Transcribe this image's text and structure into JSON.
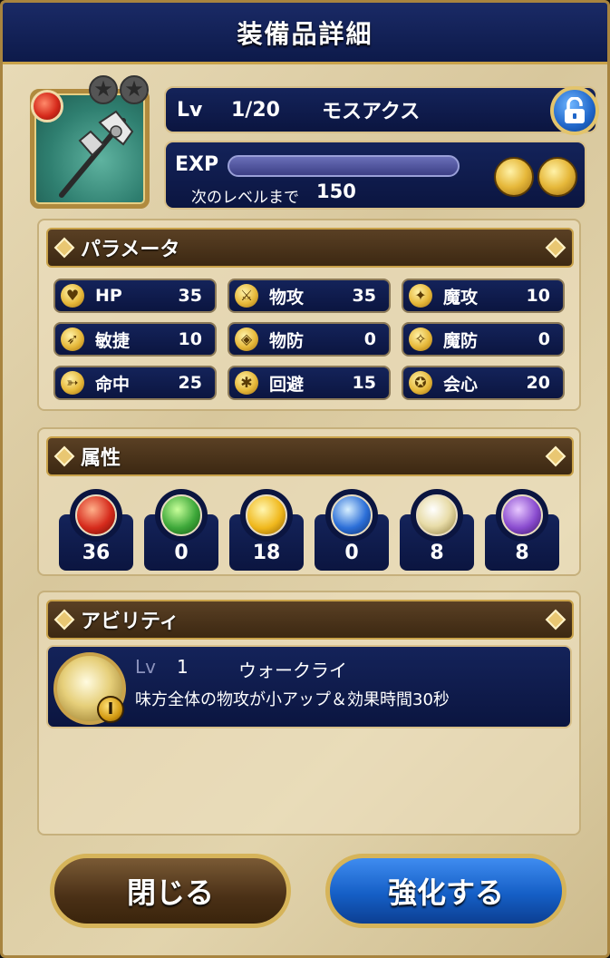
{
  "header": {
    "title": "装備品詳細"
  },
  "item": {
    "icon": "axe-weapon-icon",
    "element_badge": "fire-element-icon",
    "stars": [
      "★",
      "★"
    ],
    "level_label": "Lv",
    "level_value": "1/20",
    "name": "モスアクス",
    "lock_icon": "lock-icon"
  },
  "exp": {
    "label": "EXP",
    "progress": 0,
    "next_label": "次のレベルまで",
    "next_value": "150",
    "type_icons": [
      "shield-type-icon",
      "axe-type-icon"
    ]
  },
  "params": {
    "title": "パラメータ",
    "items": [
      {
        "label": "HP",
        "value": "35",
        "icon": "heart-icon"
      },
      {
        "label": "物攻",
        "value": "35",
        "icon": "sword-icon"
      },
      {
        "label": "魔攻",
        "value": "10",
        "icon": "staff-icon"
      },
      {
        "label": "敏捷",
        "value": "10",
        "icon": "wing-icon"
      },
      {
        "label": "物防",
        "value": "0",
        "icon": "shield-icon"
      },
      {
        "label": "魔防",
        "value": "0",
        "icon": "magic-guard-icon"
      },
      {
        "label": "命中",
        "value": "25",
        "icon": "bow-icon"
      },
      {
        "label": "回避",
        "value": "15",
        "icon": "dodge-icon"
      },
      {
        "label": "会心",
        "value": "20",
        "icon": "critical-icon"
      }
    ]
  },
  "elements": {
    "title": "属性",
    "items": [
      {
        "name": "fire",
        "value": "36",
        "color": "#d62b1c"
      },
      {
        "name": "wind",
        "value": "0",
        "color": "#3ea83a"
      },
      {
        "name": "thunder",
        "value": "18",
        "color": "#f0b81c"
      },
      {
        "name": "ice",
        "value": "0",
        "color": "#2c6fd8"
      },
      {
        "name": "light",
        "value": "8",
        "color": "#e8dca8"
      },
      {
        "name": "dark",
        "value": "8",
        "color": "#8a4ccf"
      }
    ]
  },
  "ability": {
    "title": "アビリティ",
    "icon": "war-cry-icon",
    "badge": "I",
    "level_label": "Lv",
    "level_value": "1",
    "name": "ウォークライ",
    "description": "味方全体の物攻が小アップ＆効果時間30秒"
  },
  "buttons": {
    "close": "閉じる",
    "upgrade": "強化する"
  }
}
